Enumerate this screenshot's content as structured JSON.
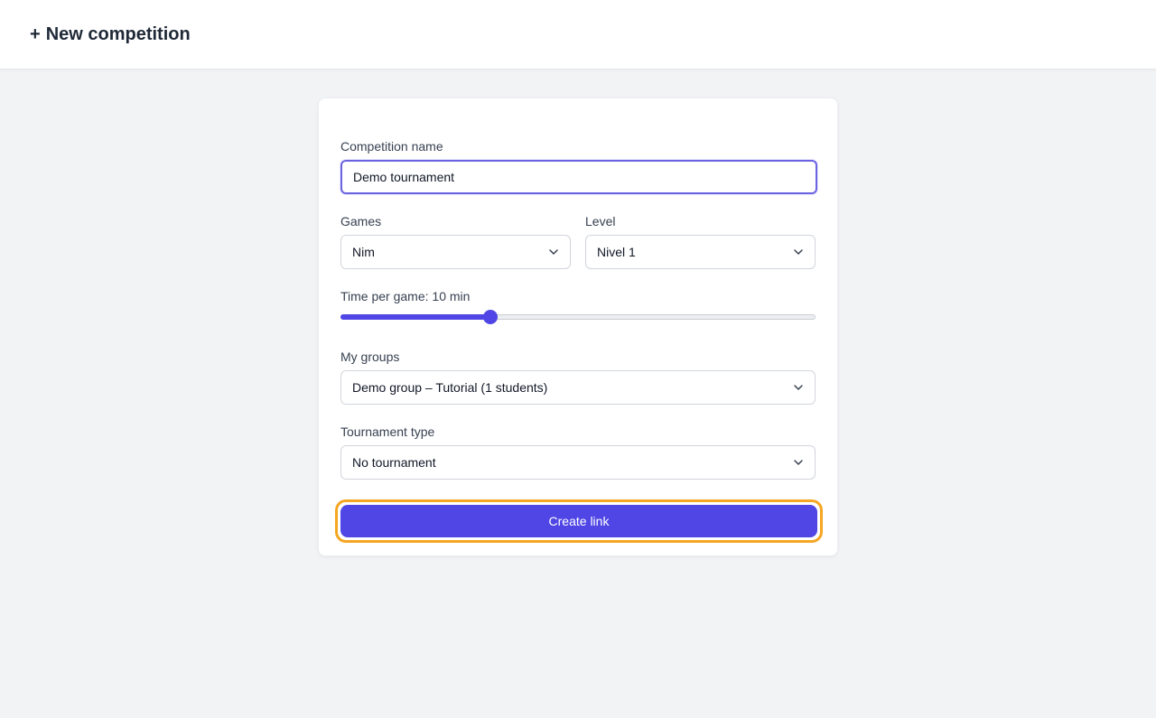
{
  "header": {
    "title_prefix": "+",
    "title": "New competition"
  },
  "form": {
    "competition_name": {
      "label": "Competition name",
      "value": "Demo tournament"
    },
    "games": {
      "label": "Games",
      "value": "Nim"
    },
    "level": {
      "label": "Level",
      "value": "Nivel 1"
    },
    "time_per_game": {
      "label": "Time per game: 10 min",
      "fraction": 0.315
    },
    "groups": {
      "label": "My groups",
      "value": "Demo group – Tutorial (1 students)"
    },
    "tournament_type": {
      "label": "Tournament type",
      "value": "No tournament"
    },
    "submit_label": "Create link"
  },
  "colors": {
    "accent": "#4f46e5",
    "focus_ring": "#f5a623"
  }
}
